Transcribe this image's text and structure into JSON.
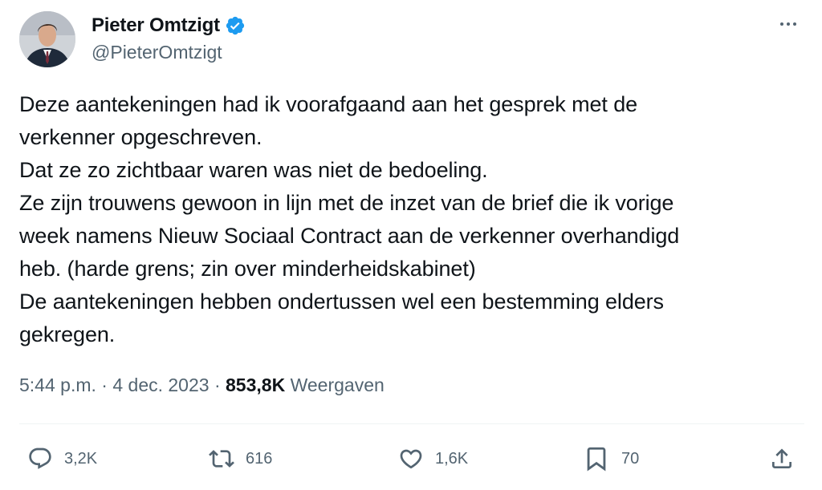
{
  "author": {
    "name": "Pieter Omtzigt",
    "handle": "@PieterOmtzigt",
    "verified": true,
    "verified_color": "#1d9bf0"
  },
  "tweet": {
    "lines": [
      "Deze aantekeningen had ik voorafgaand aan het gesprek met de",
      "verkenner opgeschreven.",
      "Dat ze zo zichtbaar waren was niet de bedoeling.",
      "Ze zijn trouwens gewoon in lijn met de inzet van de brief die ik vorige",
      "week namens Nieuw Sociaal Contract aan de verkenner overhandigd",
      "heb. (harde grens; zin over minderheidskabinet)",
      "De aantekeningen hebben ondertussen wel een bestemming elders",
      "gekregen."
    ]
  },
  "meta": {
    "time": "5:44 p.m.",
    "separator": "·",
    "date": "4 dec. 2023",
    "views_count": "853,8K",
    "views_label": "Weergaven"
  },
  "actions": {
    "reply_count": "3,2K",
    "retweet_count": "616",
    "like_count": "1,6K",
    "bookmark_count": "70"
  },
  "icons": {
    "more": "more-icon",
    "reply": "reply-icon",
    "retweet": "retweet-icon",
    "like": "heart-icon",
    "bookmark": "bookmark-icon",
    "share": "share-icon",
    "verified": "verified-badge-icon"
  }
}
